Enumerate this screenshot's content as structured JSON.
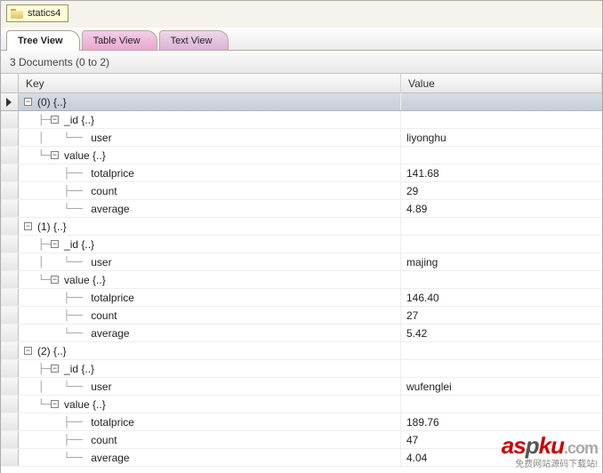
{
  "collection_name": "statics4",
  "tabs": {
    "tree": "Tree View",
    "table": "Table View",
    "text": "Text View"
  },
  "status": "3 Documents (0 to 2)",
  "columns": {
    "key": "Key",
    "value": "Value"
  },
  "docs": [
    {
      "label": "(0) {..}",
      "id_label": "_id {..}",
      "user_key": "user",
      "user_val": "liyonghu",
      "value_label": "value {..}",
      "fields": {
        "totalprice_key": "totalprice",
        "totalprice_val": "141.68",
        "count_key": "count",
        "count_val": "29",
        "average_key": "average",
        "average_val": "4.89"
      }
    },
    {
      "label": "(1) {..}",
      "id_label": "_id {..}",
      "user_key": "user",
      "user_val": "majing",
      "value_label": "value {..}",
      "fields": {
        "totalprice_key": "totalprice",
        "totalprice_val": "146.40",
        "count_key": "count",
        "count_val": "27",
        "average_key": "average",
        "average_val": "5.42"
      }
    },
    {
      "label": "(2) {..}",
      "id_label": "_id {..}",
      "user_key": "user",
      "user_val": "wufenglei",
      "value_label": "value {..}",
      "fields": {
        "totalprice_key": "totalprice",
        "totalprice_val": "189.76",
        "count_key": "count",
        "count_val": "47",
        "average_key": "average",
        "average_val": "4.04"
      }
    }
  ],
  "watermark": {
    "logo_text": "aspku",
    "tld": ".com",
    "subtitle": "免费网站源码下载站!"
  }
}
